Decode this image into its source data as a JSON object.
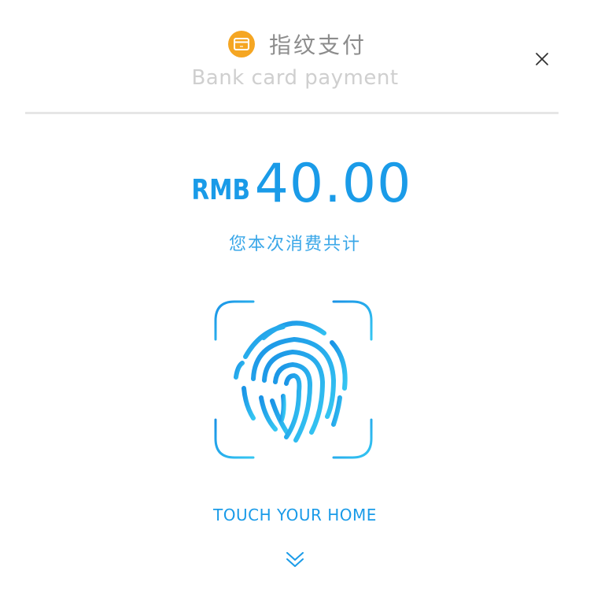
{
  "header": {
    "title_zh": "指纹支付",
    "subtitle_en": "Bank card payment",
    "payment_icon": "bank-card-icon",
    "close_icon": "close-icon"
  },
  "payment": {
    "currency": "RMB",
    "amount": "40.00",
    "note": "您本次消费共计"
  },
  "fingerprint": {
    "icon": "fingerprint-icon",
    "instruction": "TOUCH YOUR HOME"
  },
  "footer": {
    "expand_icon": "double-chevron-down-icon"
  },
  "colors": {
    "accent_blue": "#1a9be8",
    "accent_light_blue": "#33c3f0",
    "card_icon_orange": "#f5a623",
    "title_gray": "#8c8c8c",
    "subtitle_gray": "#cfcfcf",
    "divider_gray": "#e6e6e6"
  }
}
